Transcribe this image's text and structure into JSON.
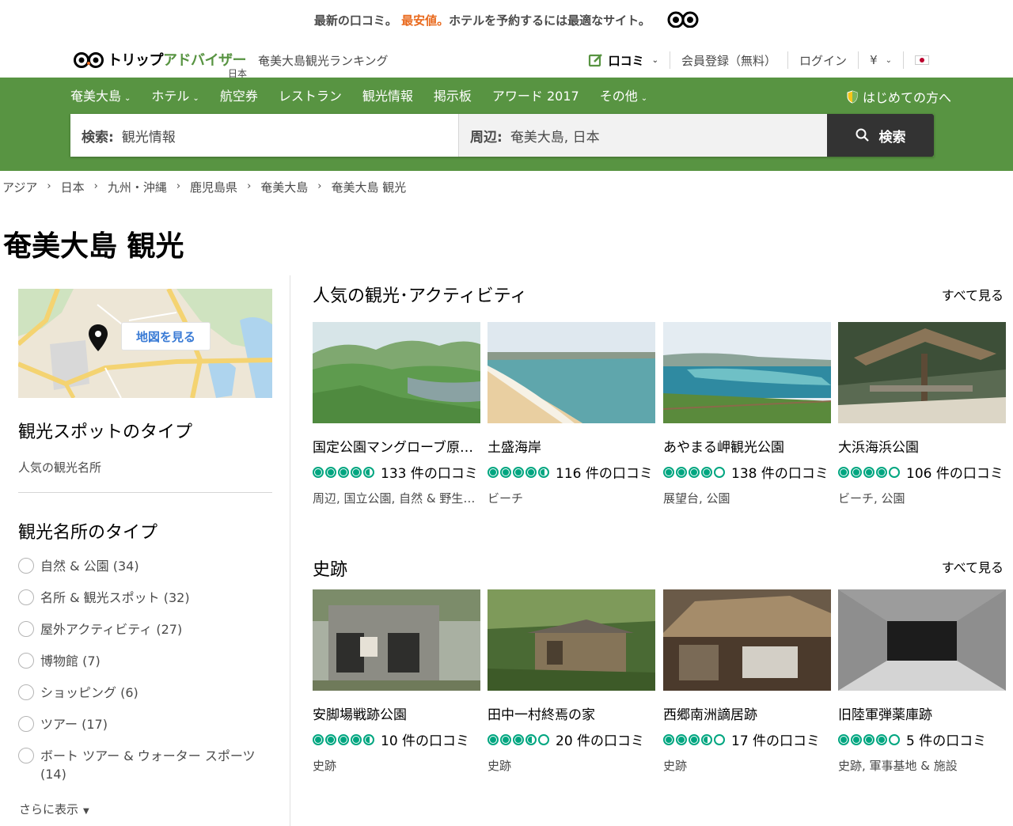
{
  "promo": {
    "text_before": "最新の口コミ。",
    "highlight": "最安値。",
    "text_after": "ホテルを予約するには最適なサイト。"
  },
  "header": {
    "logo": {
      "text_black": "トリップ",
      "text_green": "アドバイザー",
      "sub": "日本"
    },
    "ranking": "奄美大島観光ランキング",
    "nav": {
      "review": "口コミ",
      "register": "会員登録（無料）",
      "login": "ログイン",
      "currency": "¥"
    }
  },
  "greennav": {
    "items": [
      "奄美大島",
      "ホテル",
      "航空券",
      "レストラン",
      "観光情報",
      "掲示板",
      "アワード 2017",
      "その他"
    ],
    "first_time": "はじめての方へ"
  },
  "search": {
    "label1": "検索:",
    "value1": "観光情報",
    "label2": "周辺:",
    "value2": "奄美大島, 日本",
    "button": "検索"
  },
  "breadcrumb": [
    "アジア",
    "日本",
    "九州・沖縄",
    "鹿児島県",
    "奄美大島",
    "奄美大島 観光"
  ],
  "page_title": "奄美大島 観光",
  "left": {
    "map_button": "地図を見る",
    "spot_type_heading": "観光スポットのタイプ",
    "spot_type_value": "人気の観光名所",
    "attr_type_heading": "観光名所のタイプ",
    "filters": [
      "自然 & 公園 (34)",
      "名所 & 観光スポット (32)",
      "屋外アクティビティ (27)",
      "博物館 (7)",
      "ショッピング (6)",
      "ツアー (17)",
      "ボート ツアー & ウォーター スポーツ (14)"
    ],
    "more": "さらに表示"
  },
  "sections": [
    {
      "title": "人気の観光･アクティビティ",
      "see_all": "すべて見る",
      "cards": [
        {
          "name": "国定公園マングローブ原生林",
          "rating": 4.5,
          "reviews": "133 件の口コミ",
          "tags": "周辺, 国立公園, 自然 & 野生動物エリア"
        },
        {
          "name": "土盛海岸",
          "rating": 4.5,
          "reviews": "116 件の口コミ",
          "tags": "ビーチ"
        },
        {
          "name": "あやまる岬観光公園",
          "rating": 4,
          "reviews": "138 件の口コミ",
          "tags": "展望台, 公園"
        },
        {
          "name": "大浜海浜公園",
          "rating": 4,
          "reviews": "106 件の口コミ",
          "tags": "ビーチ, 公園"
        }
      ]
    },
    {
      "title": "史跡",
      "see_all": "すべて見る",
      "cards": [
        {
          "name": "安脚場戦跡公園",
          "rating": 4.5,
          "reviews": "10 件の口コミ",
          "tags": "史跡"
        },
        {
          "name": "田中一村終焉の家",
          "rating": 3.5,
          "reviews": "20 件の口コミ",
          "tags": "史跡"
        },
        {
          "name": "西郷南洲謫居跡",
          "rating": 3.5,
          "reviews": "17 件の口コミ",
          "tags": "史跡"
        },
        {
          "name": "旧陸軍弾薬庫跡",
          "rating": 4,
          "reviews": "5 件の口コミ",
          "tags": "史跡, 軍事基地 & 施設"
        }
      ]
    }
  ],
  "icons": [
    "owl-logo-icon",
    "edit-review-icon",
    "shield-icon",
    "search-icon",
    "map-pin-icon",
    "chevron-down-icon"
  ],
  "colors": {
    "brand_green": "#589442",
    "accent_orange": "#e96a1e",
    "bubble_green": "#00a680",
    "search_button": "#333333"
  }
}
